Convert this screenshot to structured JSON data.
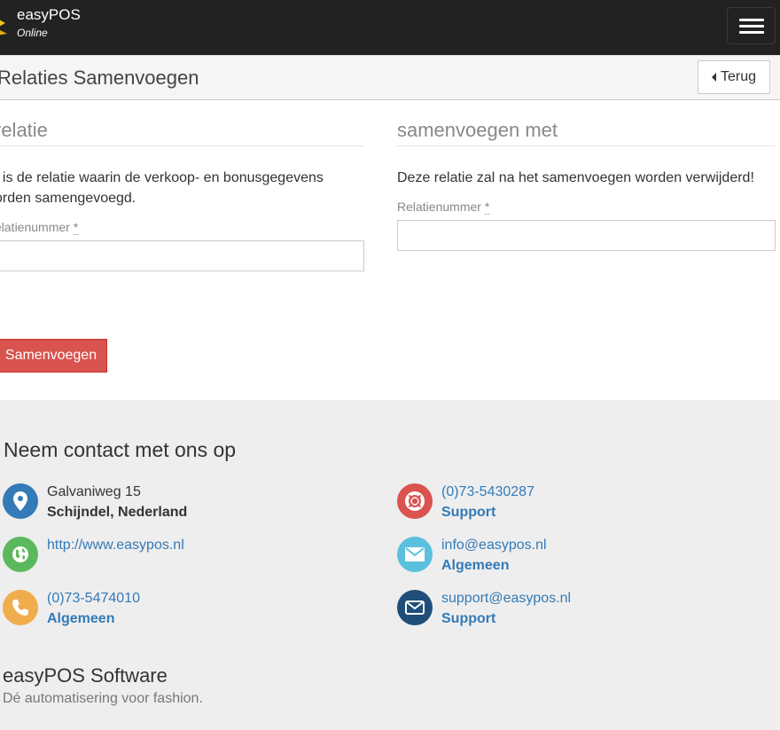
{
  "header": {
    "brand": "easyPOS",
    "brand_sub": "Online",
    "menu_icon": "hamburger-icon"
  },
  "page": {
    "title": "Relaties Samenvoegen",
    "back_label": "Terug",
    "back_icon": "caret-left-icon"
  },
  "form": {
    "left": {
      "heading": "relatie",
      "text_line1": "t is de relatie waarin de verkoop- en bonusgegevens",
      "text_line2": "orden samengevoegd.",
      "field_label": "elatienummer",
      "required_mark": "*",
      "value": ""
    },
    "right": {
      "heading": "samenvoegen met",
      "text": "Deze relatie zal na het samenvoegen worden verwijderd!",
      "field_label": "Relatienummer",
      "required_mark": "*",
      "value": ""
    },
    "submit_label": "Samenvoegen"
  },
  "footer": {
    "title": "Neem contact met ons op",
    "contacts": [
      {
        "icon": "map-marker-icon",
        "line1": "Galvaniweg 15",
        "line2": "Schijndel, Nederland",
        "color": "#337ab7"
      },
      {
        "icon": "life-ring-icon",
        "line1": "(0)73-5430287",
        "line2": "Support",
        "color": "#d9534f"
      },
      {
        "icon": "globe-icon",
        "line1": "http://www.easypos.nl",
        "line2": "",
        "color": "#5cb85c"
      },
      {
        "icon": "envelope-icon",
        "line1": "info@easypos.nl",
        "line2": "Algemeen",
        "color": "#5bc0de"
      },
      {
        "icon": "phone-icon",
        "line1": "(0)73-5474010",
        "line2": "Algemeen",
        "color": "#f0ad4e"
      },
      {
        "icon": "envelope-icon",
        "line1": "support@easypos.nl",
        "line2": "Support",
        "color": "#1f4e79"
      }
    ],
    "company": "easyPOS Software",
    "tagline": "Dé automatisering voor fashion."
  }
}
